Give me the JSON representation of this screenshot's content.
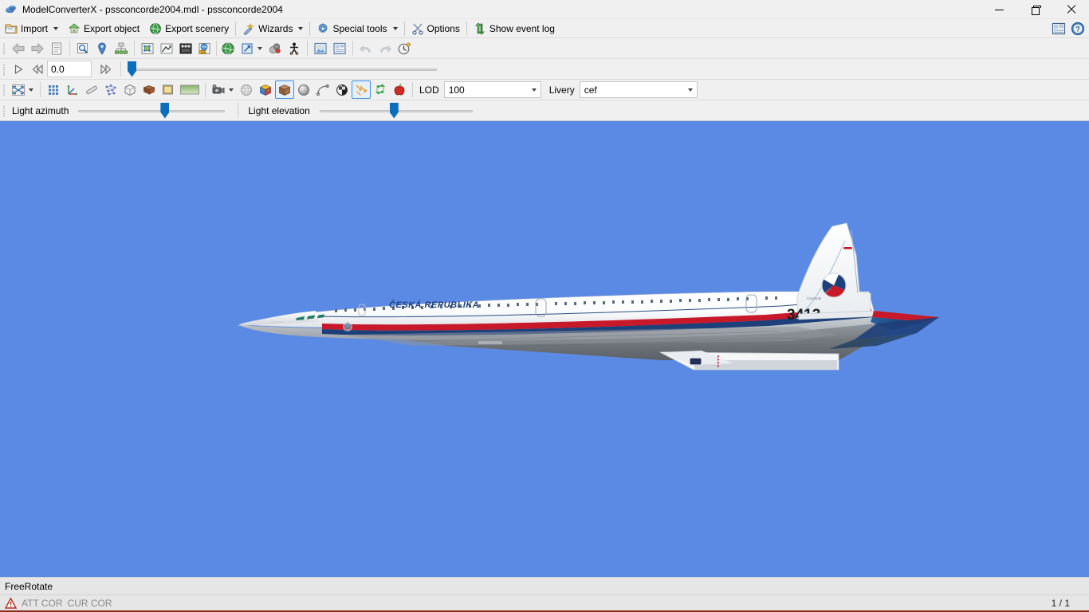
{
  "window": {
    "title": "ModelConverterX - pssconcorde2004.mdl - pssconcorde2004",
    "app_icon": "cube-blue-icon",
    "minimize_label": "Minimize",
    "maximize_label": "Maximize",
    "close_label": "Close"
  },
  "menubar": {
    "items": [
      {
        "label": "Import",
        "icon": "import-folder-icon",
        "has_dropdown": true
      },
      {
        "label": "Export object",
        "icon": "export-object-house-icon",
        "has_dropdown": false
      },
      {
        "label": "Export scenery",
        "icon": "export-scenery-globe-icon",
        "has_dropdown": false
      },
      {
        "label": "Wizards",
        "icon": "wand-icon",
        "has_dropdown": true
      },
      {
        "label": "Special tools",
        "icon": "gear-icon",
        "has_dropdown": true
      },
      {
        "label": "Options",
        "icon": "tools-scissors-icon",
        "has_dropdown": false
      },
      {
        "label": "Show event log",
        "icon": "event-log-arrows-icon",
        "has_dropdown": false
      }
    ],
    "right_buttons": [
      {
        "name": "panel-toggle-icon",
        "label": "Toggle panel"
      },
      {
        "name": "help-icon",
        "label": "Help"
      }
    ]
  },
  "toolbar_main": {
    "buttons": [
      {
        "name": "back-arrow-icon",
        "label": "Back",
        "state": "normal"
      },
      {
        "name": "forward-arrow-icon",
        "label": "Forward",
        "state": "normal"
      },
      {
        "name": "object-list-icon",
        "label": "Object list",
        "state": "normal"
      },
      {
        "sep": true
      },
      {
        "name": "preview-search-icon",
        "label": "Preview",
        "state": "normal"
      },
      {
        "name": "location-pin-icon",
        "label": "Placement",
        "state": "normal"
      },
      {
        "name": "hierarchy-icon",
        "label": "Hierarchy editor",
        "state": "normal"
      },
      {
        "sep": true
      },
      {
        "name": "attached-objects-icon",
        "label": "Attached objects",
        "state": "normal"
      },
      {
        "name": "animation-editor-icon",
        "label": "Animation editor",
        "state": "normal"
      },
      {
        "name": "material-editor-icon",
        "label": "Material editor",
        "state": "normal"
      },
      {
        "name": "texture-editor-icon",
        "label": "Texture editor",
        "state": "normal"
      },
      {
        "name": "scenery-globe-icon",
        "label": "Scenery",
        "state": "normal"
      },
      {
        "name": "scale-object-icon",
        "label": "Scale object",
        "state": "normal",
        "has_dropdown": true
      },
      {
        "name": "lod-spheres-icon",
        "label": "LOD settings",
        "state": "normal"
      },
      {
        "name": "crash-tree-icon",
        "label": "Crash tree",
        "state": "normal"
      },
      {
        "sep": true
      },
      {
        "name": "image-preview-icon",
        "label": "Image preview",
        "state": "normal"
      },
      {
        "name": "report-icon",
        "label": "Report",
        "state": "normal"
      },
      {
        "sep": true
      },
      {
        "name": "undo-icon",
        "label": "Undo",
        "state": "disabled"
      },
      {
        "name": "redo-icon",
        "label": "Redo",
        "state": "disabled"
      },
      {
        "name": "history-clock-icon",
        "label": "History",
        "state": "normal"
      }
    ]
  },
  "toolbar_animation": {
    "play_label": "Play animation",
    "rewind_label": "Rewind",
    "forward_label": "Forward",
    "frame_value": "0.0",
    "slider": {
      "name": "animation-frame-slider",
      "value": 0,
      "min": 0,
      "max": 100
    }
  },
  "toolbar_view": {
    "buttons": [
      {
        "name": "fit-to-view-icon",
        "label": "Fit to view",
        "state": "normal",
        "has_dropdown": true
      },
      {
        "sep": true
      },
      {
        "name": "grid-icon",
        "label": "Show grid",
        "state": "normal"
      },
      {
        "name": "axis-icon",
        "label": "Show axis",
        "state": "normal"
      },
      {
        "name": "measure-icon",
        "label": "Measure",
        "state": "normal"
      },
      {
        "name": "vertices-icon",
        "label": "Show vertices",
        "state": "normal"
      },
      {
        "name": "wireframe-box-icon",
        "label": "Wireframe",
        "state": "normal"
      },
      {
        "name": "texture-brick-icon",
        "label": "Textured",
        "state": "normal"
      },
      {
        "name": "flat-shade-icon",
        "label": "Flat shading",
        "state": "normal"
      },
      {
        "name": "gradient-background-icon",
        "label": "Background",
        "state": "normal"
      },
      {
        "sep": true
      },
      {
        "name": "camera-icon",
        "label": "Camera",
        "state": "normal",
        "has_dropdown": true
      },
      {
        "name": "mesh-sphere-icon",
        "label": "Mesh",
        "state": "normal"
      },
      {
        "name": "colored-cube-icon",
        "label": "Colored cube",
        "state": "normal"
      },
      {
        "name": "textured-cube-icon",
        "label": "Textured cube",
        "state": "selected"
      },
      {
        "name": "shaded-sphere-icon",
        "label": "Shaded sphere",
        "state": "normal"
      },
      {
        "name": "spline-icon",
        "label": "Spline",
        "state": "normal"
      },
      {
        "name": "checker-sphere-icon",
        "label": "Checkered",
        "state": "normal"
      },
      {
        "name": "normals-arrows-icon",
        "label": "Show normals",
        "state": "selected"
      },
      {
        "name": "swap-green-arrows-icon",
        "label": "Swap",
        "state": "normal"
      },
      {
        "name": "red-apple-icon",
        "label": "Apple test object",
        "state": "normal"
      },
      {
        "sep": true
      }
    ],
    "lod": {
      "label": "LOD",
      "value": "100",
      "name": "lod-combo"
    },
    "livery": {
      "label": "Livery",
      "value": "cef",
      "name": "livery-combo"
    }
  },
  "toolbar_light": {
    "azimuth": {
      "label": "Light azimuth",
      "name": "light-azimuth-slider",
      "value": 60
    },
    "elevation": {
      "label": "Light elevation",
      "name": "light-elevation-slider",
      "value": 48
    }
  },
  "viewport": {
    "name": "model-3d-viewport",
    "background_color": "#5b8ae4",
    "model": {
      "type": "concorde-aircraft",
      "fuselage_title": "ČESKÁ REPUBLIKA",
      "tail_number": "3413",
      "tail_small_text": "Concorde",
      "roundel": "czech-roundel",
      "colors": {
        "body": "#ffffff",
        "stripe_red": "#c8192a",
        "stripe_blue": "#1d3f7a",
        "underside": "#6b6f74",
        "wing_dark": "#1a3a6b"
      }
    }
  },
  "statusbar": {
    "mode": "FreeRotate",
    "warning_icon": "warning-triangle-icon",
    "att_cor": "ATT COR",
    "cur_cor": "CUR COR",
    "page_indicator": "1 / 1"
  }
}
